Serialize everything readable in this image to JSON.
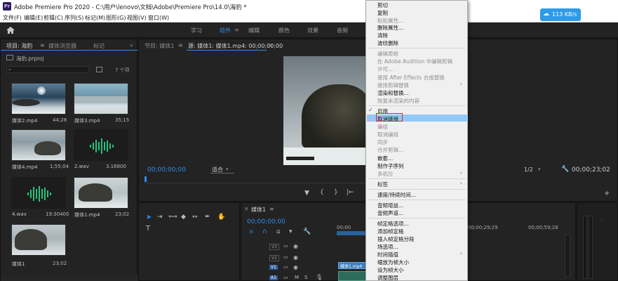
{
  "titlebar": {
    "title": "Adobe Premiere Pro 2020 - C:\\用户\\lenovo\\文档\\Adobe\\Premiere Pro\\14.0\\海豹 *",
    "logo_text": "Pr"
  },
  "menubar": {
    "items": [
      "文件(F)",
      "编辑(E)",
      "剪辑(C)",
      "序列(S)",
      "标记(M)",
      "图形(G)",
      "视图(V)",
      "窗口(W)"
    ]
  },
  "workspace": {
    "tabs": [
      "学习",
      "组件",
      "编辑",
      "颜色",
      "效果",
      "音频"
    ],
    "active_index": 1
  },
  "project": {
    "tabs": [
      "项目: 海豹",
      "媒体浏览器",
      "标记"
    ],
    "filename": "海豹.prproj",
    "item_count": "7 个项",
    "items": [
      {
        "name": "媒体2.mp4",
        "duration": "44;28"
      },
      {
        "name": "媒体3.mp4",
        "duration": "35;15"
      },
      {
        "name": "媒体4.mp4",
        "duration": "1;55;04"
      },
      {
        "name": "2.wav",
        "duration": "3.16800"
      },
      {
        "name": "4.wav",
        "duration": "19:30400"
      },
      {
        "name": "媒体1.mp4",
        "duration": "23;02"
      },
      {
        "name": "媒体1",
        "duration": "23;02"
      }
    ]
  },
  "source": {
    "label": "节目: 媒体1",
    "tab": "源: 媒体1: 媒体1.mp4: 00;00;00;00"
  },
  "program": {
    "timecode": "00;00;00;00",
    "fit": "适合",
    "fraction": "1/2",
    "end_timecode": "00;00;23;02"
  },
  "timeline": {
    "tab": "媒体1",
    "timecode": "00;00;00;00",
    "ruler": [
      "00;00",
      "00;00;29;29",
      "00;00;59;28"
    ],
    "tracks": [
      "V3",
      "V2",
      "V1",
      "A1"
    ],
    "clip_label": "媒体1.mp4"
  },
  "speed_widget": {
    "text": "113 KB/s"
  },
  "context_menu": {
    "items": [
      {
        "label": "剪切",
        "disabled": false
      },
      {
        "label": "复制",
        "disabled": false
      },
      {
        "label": "粘贴属性...",
        "disabled": true
      },
      {
        "label": "删除属性...",
        "disabled": false
      },
      {
        "label": "清除",
        "disabled": false
      },
      {
        "label": "波纹删除",
        "disabled": false
      },
      {
        "label": "编辑原始",
        "disabled": true
      },
      {
        "label": "在 Adobe Audition 中编辑剪辑",
        "disabled": true
      },
      {
        "label": "许可...",
        "disabled": true
      },
      {
        "label": "使用 After Effects 合成替换",
        "disabled": true
      },
      {
        "label": "使用剪辑替换",
        "disabled": true,
        "submenu": true
      },
      {
        "label": "渲染和替换...",
        "disabled": false
      },
      {
        "label": "恢复未渲染的内容",
        "disabled": true
      },
      {
        "label": "启用",
        "disabled": false,
        "checked": true
      },
      {
        "label": "取消链接",
        "disabled": false,
        "highlighted": true
      },
      {
        "label": "编组",
        "disabled": true
      },
      {
        "label": "取消编组",
        "disabled": true
      },
      {
        "label": "同步",
        "disabled": true
      },
      {
        "label": "合并剪辑...",
        "disabled": true
      },
      {
        "label": "嵌套...",
        "disabled": false
      },
      {
        "label": "制作子序列",
        "disabled": false
      },
      {
        "label": "多机位",
        "disabled": true,
        "submenu": true
      },
      {
        "label": "标签",
        "disabled": false,
        "submenu": true
      },
      {
        "label": "速度/持续时间...",
        "disabled": false
      },
      {
        "label": "音频增益...",
        "disabled": false
      },
      {
        "label": "音频声道...",
        "disabled": false
      },
      {
        "label": "帧定格选项...",
        "disabled": false
      },
      {
        "label": "添加帧定格",
        "disabled": false
      },
      {
        "label": "插入帧定格分段",
        "disabled": false
      },
      {
        "label": "场选项...",
        "disabled": false
      },
      {
        "label": "时间插值",
        "disabled": false,
        "submenu": true
      },
      {
        "label": "缩放为帧大小",
        "disabled": false
      },
      {
        "label": "设为帧大小",
        "disabled": false
      },
      {
        "label": "调整图层",
        "disabled": false
      }
    ]
  }
}
